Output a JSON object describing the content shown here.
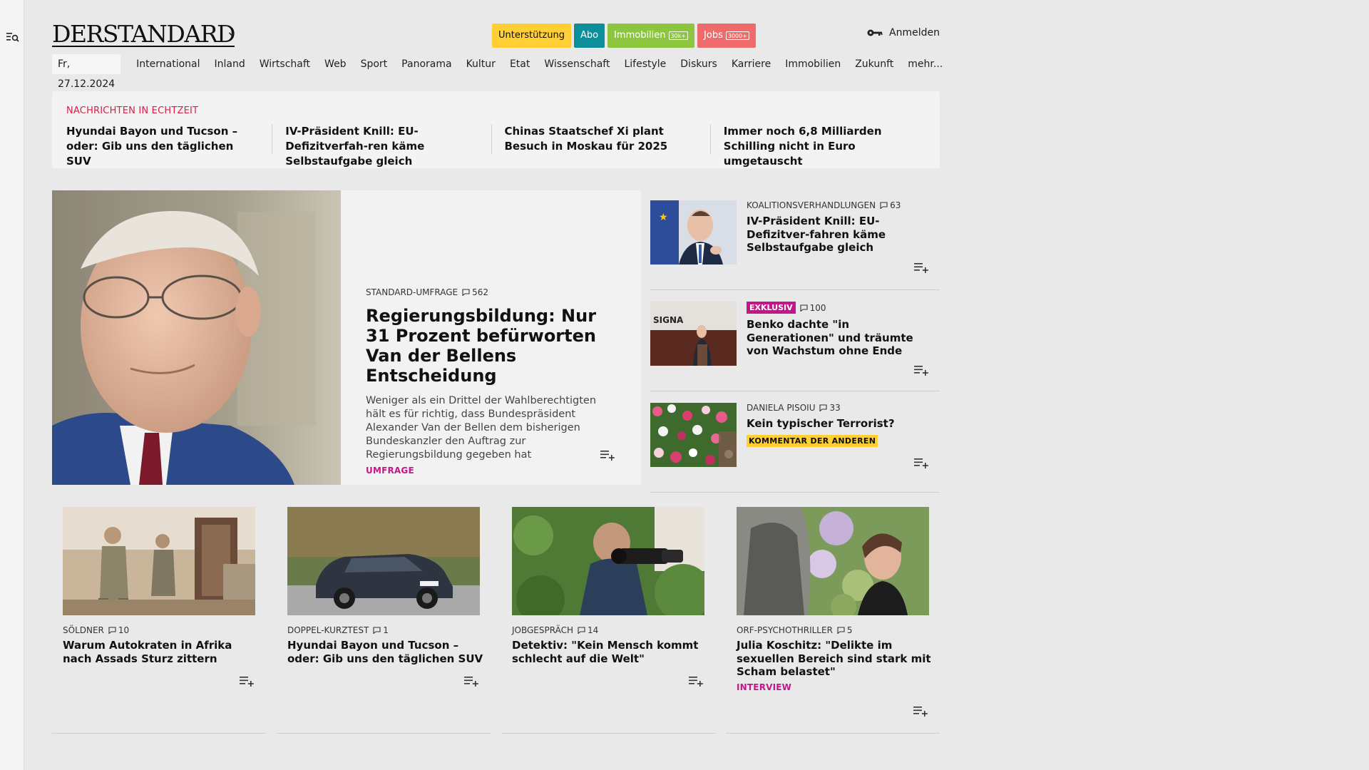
{
  "header": {
    "logo": "DERSTANDARD",
    "pills": [
      {
        "label": "Unterstützung",
        "badge": "",
        "bg": "#ffcf33",
        "fg": "#111111"
      },
      {
        "label": "Abo",
        "badge": "",
        "bg": "#0a8f9b",
        "fg": "#ffffff"
      },
      {
        "label": "Immobilien",
        "badge": "30k+",
        "bg": "#8cc63f",
        "fg": "#ffffff"
      },
      {
        "label": "Jobs",
        "badge": "3000+",
        "bg": "#ef6b6b",
        "fg": "#ffffff"
      }
    ],
    "login_label": "Anmelden"
  },
  "nav": {
    "date": "Fr, 27.12.2024",
    "items": [
      "International",
      "Inland",
      "Wirtschaft",
      "Web",
      "Sport",
      "Panorama",
      "Kultur",
      "Etat",
      "Wissenschaft",
      "Lifestyle",
      "Diskurs",
      "Karriere",
      "Immobilien",
      "Zukunft",
      "mehr..."
    ]
  },
  "ticker": {
    "heading": "NACHRICHTEN IN ECHTZEIT",
    "items": [
      "Hyundai Bayon und Tucson – oder: Gib uns den täglichen SUV",
      "IV-Präsident Knill: EU-Defizitverfah-ren käme Selbstaufgabe gleich",
      "Chinas Staatschef Xi plant Besuch in Moskau für 2025",
      "Immer noch 6,8 Milliarden Schilling nicht in Euro umgetauscht"
    ]
  },
  "lead": {
    "kicker": "STANDARD-UMFRAGE",
    "comments": "562",
    "title": "Regierungsbildung: Nur 31 Prozent befürworten Van der Bellens Entscheidung",
    "teaser": "Weniger als ein Drittel der Wahlberechtigten hält es für richtig, dass Bundespräsident Alexander Van der Bellen dem bisherigen Bundeskanzler den Auftrag zur Regierungsbildung gegeben hat",
    "tag": "UMFRAGE"
  },
  "side": [
    {
      "kicker": "KOALITIONSVERHANDLUNGEN",
      "comments": "63",
      "badge": "",
      "title": "IV-Präsident Knill: EU-Defizitver-fahren käme Selbstaufgabe gleich",
      "tag": ""
    },
    {
      "kicker": "",
      "comments": "100",
      "badge": "EXKLUSIV",
      "title": "Benko dachte \"in Generationen\" und träumte von Wachstum ohne Ende",
      "tag": "",
      "thumb_text": "SIGNA"
    },
    {
      "kicker": "DANIELA PISOIU",
      "comments": "33",
      "badge": "",
      "title": "Kein typischer Terrorist?",
      "tag": "KOMMENTAR DER ANDEREN"
    }
  ],
  "cards": [
    {
      "kicker": "SÖLDNER",
      "comments": "10",
      "title": "Warum Autokraten in Afrika nach Assads Sturz zittern",
      "tag": ""
    },
    {
      "kicker": "DOPPEL-KURZTEST",
      "comments": "1",
      "title": "Hyundai Bayon und Tucson – oder: Gib uns den täglichen SUV",
      "tag": ""
    },
    {
      "kicker": "JOBGESPRÄCH",
      "comments": "14",
      "title": "Detektiv: \"Kein Mensch kommt schlecht auf die Welt\"",
      "tag": ""
    },
    {
      "kicker": "ORF-PSYCHOTHRILLER",
      "comments": "5",
      "title": "Julia Koschitz: \"Delikte im sexuellen Bereich sind stark mit Scham belastet\"",
      "tag": "INTERVIEW"
    }
  ],
  "icons": {
    "menu": "search-menu-icon",
    "login": "key-icon",
    "comment": "comment-icon",
    "add": "add-to-list-icon"
  },
  "colors": {
    "accent_red": "#d62046",
    "accent_pink": "#c4168a",
    "accent_yellow": "#ffcf33",
    "page_bg": "#e9e9e9"
  }
}
